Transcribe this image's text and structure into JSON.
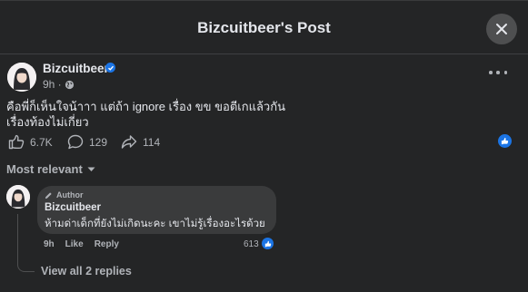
{
  "header": {
    "title": "Bizcuitbeer's Post",
    "close_icon": "close-icon"
  },
  "post": {
    "author": "Bizcuitbeer",
    "time": "9h ·",
    "audience_icon": "globe-icon",
    "text_line1": "คือพี่ก็เห็นใจน้าาา แต่ถ้า ignore เรื่อง ขข ขอตีเกแล้วกัน",
    "text_line2": "เรื่องท้องไม่เกี่ยว"
  },
  "stats": {
    "likes": "6.7K",
    "comments": "129",
    "shares": "114"
  },
  "sort": {
    "label": "Most relevant"
  },
  "comment": {
    "badge": "Author",
    "name": "Bizcuitbeer",
    "text": "ห้ามด่าเด็กที่ยังไม่เกิดนะคะ เขาไม่รู้เรื่องอะไรด้วย",
    "time": "9h",
    "like_label": "Like",
    "reply_label": "Reply",
    "reactions": "613"
  },
  "replies": {
    "label": "View all 2 replies"
  },
  "colors": {
    "background": "#242526",
    "bubble": "#3a3b3c",
    "accent": "#1b74e4",
    "muted": "#b0b3b8"
  }
}
